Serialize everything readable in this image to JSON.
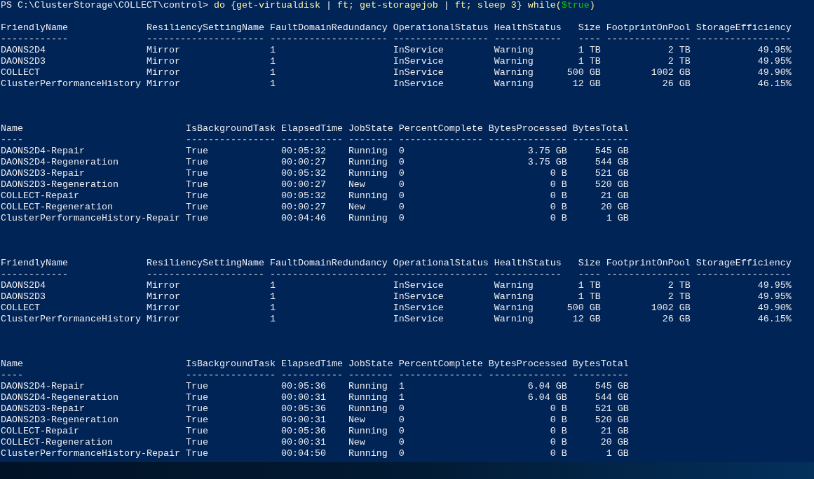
{
  "prompt": "PS C:\\ClusterStorage\\COLLECT\\control>",
  "command": [
    {
      "text": "do {get-virtualdisk",
      "kind": "command"
    },
    {
      "text": " | ",
      "kind": "plain"
    },
    {
      "text": "ft; get-storagejob",
      "kind": "command"
    },
    {
      "text": " | ",
      "kind": "plain"
    },
    {
      "text": "ft; sleep 3} while(",
      "kind": "command"
    },
    {
      "text": "$true",
      "kind": "variable"
    },
    {
      "text": ")",
      "kind": "command"
    }
  ],
  "tables": [
    {
      "columns": [
        {
          "name": "FriendlyName",
          "rule": "------------",
          "kind": "text"
        },
        {
          "name": "ResiliencySettingName",
          "rule": "---------------------",
          "kind": "text"
        },
        {
          "name": "FaultDomainRedundancy",
          "rule": "---------------------",
          "kind": "text"
        },
        {
          "name": "OperationalStatus",
          "rule": "-----------------",
          "kind": "text"
        },
        {
          "name": "HealthStatus",
          "rule": "------------",
          "kind": "text"
        },
        {
          "name": "Size",
          "rule": "----",
          "kind": "quantity"
        },
        {
          "name": "FootprintOnPool",
          "rule": "---------------",
          "kind": "quantity"
        },
        {
          "name": "StorageEfficiency",
          "rule": "-----------------",
          "kind": "quantity"
        }
      ],
      "rows": [
        [
          "DAONS2D4",
          "Mirror",
          "1",
          "InService",
          "Warning",
          "1 TB",
          "2 TB",
          "49.95%"
        ],
        [
          "DAONS2D3",
          "Mirror",
          "1",
          "InService",
          "Warning",
          "1 TB",
          "2 TB",
          "49.95%"
        ],
        [
          "COLLECT",
          "Mirror",
          "1",
          "InService",
          "Warning",
          "500 GB",
          "1002 GB",
          "49.90%"
        ],
        [
          "ClusterPerformanceHistory",
          "Mirror",
          "1",
          "InService",
          "Warning",
          "12 GB",
          "26 GB",
          "46.15%"
        ]
      ]
    },
    {
      "columns": [
        {
          "name": "Name",
          "rule": "----",
          "kind": "text"
        },
        {
          "name": "IsBackgroundTask",
          "rule": "----------------",
          "kind": "text"
        },
        {
          "name": "ElapsedTime",
          "rule": "-----------",
          "kind": "text"
        },
        {
          "name": "JobState",
          "rule": "--------",
          "kind": "text"
        },
        {
          "name": "PercentComplete",
          "rule": "---------------",
          "kind": "text"
        },
        {
          "name": "BytesProcessed",
          "rule": "--------------",
          "kind": "quantity"
        },
        {
          "name": "BytesTotal",
          "rule": "----------",
          "kind": "quantity"
        }
      ],
      "rows": [
        [
          "DAONS2D4-Repair",
          "True",
          "00:05:32",
          "Running",
          "0",
          "3.75 GB",
          "545 GB"
        ],
        [
          "DAONS2D4-Regeneration",
          "True",
          "00:00:27",
          "Running",
          "0",
          "3.75 GB",
          "544 GB"
        ],
        [
          "DAONS2D3-Repair",
          "True",
          "00:05:32",
          "Running",
          "0",
          "0 B",
          "521 GB"
        ],
        [
          "DAONS2D3-Regeneration",
          "True",
          "00:00:27",
          "New",
          "0",
          "0 B",
          "520 GB"
        ],
        [
          "COLLECT-Repair",
          "True",
          "00:05:32",
          "Running",
          "0",
          "0 B",
          "21 GB"
        ],
        [
          "COLLECT-Regeneration",
          "True",
          "00:00:27",
          "New",
          "0",
          "0 B",
          "20 GB"
        ],
        [
          "ClusterPerformanceHistory-Repair",
          "True",
          "00:04:46",
          "Running",
          "0",
          "0 B",
          "1 GB"
        ]
      ]
    },
    {
      "columns": [
        {
          "name": "FriendlyName",
          "rule": "------------",
          "kind": "text"
        },
        {
          "name": "ResiliencySettingName",
          "rule": "---------------------",
          "kind": "text"
        },
        {
          "name": "FaultDomainRedundancy",
          "rule": "---------------------",
          "kind": "text"
        },
        {
          "name": "OperationalStatus",
          "rule": "-----------------",
          "kind": "text"
        },
        {
          "name": "HealthStatus",
          "rule": "------------",
          "kind": "text"
        },
        {
          "name": "Size",
          "rule": "----",
          "kind": "quantity"
        },
        {
          "name": "FootprintOnPool",
          "rule": "---------------",
          "kind": "quantity"
        },
        {
          "name": "StorageEfficiency",
          "rule": "-----------------",
          "kind": "quantity"
        }
      ],
      "rows": [
        [
          "DAONS2D4",
          "Mirror",
          "1",
          "InService",
          "Warning",
          "1 TB",
          "2 TB",
          "49.95%"
        ],
        [
          "DAONS2D3",
          "Mirror",
          "1",
          "InService",
          "Warning",
          "1 TB",
          "2 TB",
          "49.95%"
        ],
        [
          "COLLECT",
          "Mirror",
          "1",
          "InService",
          "Warning",
          "500 GB",
          "1002 GB",
          "49.90%"
        ],
        [
          "ClusterPerformanceHistory",
          "Mirror",
          "1",
          "InService",
          "Warning",
          "12 GB",
          "26 GB",
          "46.15%"
        ]
      ]
    },
    {
      "columns": [
        {
          "name": "Name",
          "rule": "----",
          "kind": "text"
        },
        {
          "name": "IsBackgroundTask",
          "rule": "----------------",
          "kind": "text"
        },
        {
          "name": "ElapsedTime",
          "rule": "-----------",
          "kind": "text"
        },
        {
          "name": "JobState",
          "rule": "--------",
          "kind": "text"
        },
        {
          "name": "PercentComplete",
          "rule": "---------------",
          "kind": "text"
        },
        {
          "name": "BytesProcessed",
          "rule": "--------------",
          "kind": "quantity"
        },
        {
          "name": "BytesTotal",
          "rule": "----------",
          "kind": "quantity"
        }
      ],
      "rows": [
        [
          "DAONS2D4-Repair",
          "True",
          "00:05:36",
          "Running",
          "1",
          "6.04 GB",
          "545 GB"
        ],
        [
          "DAONS2D4-Regeneration",
          "True",
          "00:00:31",
          "Running",
          "1",
          "6.04 GB",
          "544 GB"
        ],
        [
          "DAONS2D3-Repair",
          "True",
          "00:05:36",
          "Running",
          "0",
          "0 B",
          "521 GB"
        ],
        [
          "DAONS2D3-Regeneration",
          "True",
          "00:00:31",
          "New",
          "0",
          "0 B",
          "520 GB"
        ],
        [
          "COLLECT-Repair",
          "True",
          "00:05:36",
          "Running",
          "0",
          "0 B",
          "21 GB"
        ],
        [
          "COLLECT-Regeneration",
          "True",
          "00:00:31",
          "New",
          "0",
          "0 B",
          "20 GB"
        ],
        [
          "ClusterPerformanceHistory-Repair",
          "True",
          "00:04:50",
          "Running",
          "0",
          "0 B",
          "1 GB"
        ]
      ]
    }
  ]
}
